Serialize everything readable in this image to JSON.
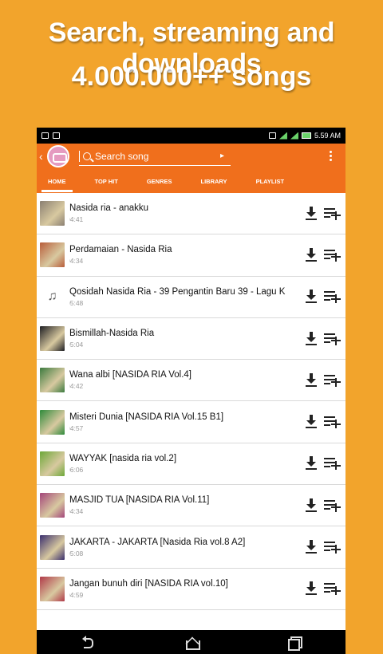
{
  "promo": {
    "line1": "Search, streaming and downloads",
    "line2": "4.000.000++ songs"
  },
  "statusbar": {
    "time": "5.59 AM"
  },
  "appbar": {
    "search_placeholder": "Search song",
    "back_icon": "chevron-left-icon",
    "menu_icon": "overflow-menu-icon"
  },
  "tabs": [
    {
      "label": "HOME",
      "active": true
    },
    {
      "label": "TOP HIT",
      "active": false
    },
    {
      "label": "GENRES",
      "active": false
    },
    {
      "label": "LIBRARY",
      "active": false
    },
    {
      "label": "PLAYLIST",
      "active": false
    }
  ],
  "songs": [
    {
      "title": "Nasida ria - anakku",
      "duration": "04:41",
      "thumb_color": "#8a7f72"
    },
    {
      "title": "Perdamaian - Nasida Ria",
      "duration": "04:34",
      "thumb_color": "#b85d3a"
    },
    {
      "title": "Qosidah Nasida Ria - 39 Pengantin Baru 39 - Lagu K",
      "duration": "05:48",
      "thumb_color": "none"
    },
    {
      "title": "Bismillah-Nasida Ria",
      "duration": "05:04",
      "thumb_color": "#1d1d22"
    },
    {
      "title": "Wana albi [NASIDA RIA Vol.4]",
      "duration": "04:42",
      "thumb_color": "#3c7a3e"
    },
    {
      "title": "Misteri Dunia [NASIDA RIA Vol.15 B1]",
      "duration": "04:57",
      "thumb_color": "#2e8a3a"
    },
    {
      "title": "WAYYAK [nasida ria vol.2]",
      "duration": "06:06",
      "thumb_color": "#6da838"
    },
    {
      "title": "MASJID TUA [NASIDA RIA Vol.11]",
      "duration": "04:34",
      "thumb_color": "#a3457a"
    },
    {
      "title": "JAKARTA - JAKARTA [Nasida Ria vol.8 A2]",
      "duration": "05:08",
      "thumb_color": "#3a2f6e"
    },
    {
      "title": "Jangan bunuh diri [NASIDA RIA vol.10]",
      "duration": "04:59",
      "thumb_color": "#b03a48"
    }
  ],
  "colors": {
    "background": "#F2A42C",
    "appbar": "#F06F1C"
  },
  "icons": {
    "download": "download-icon",
    "add_playlist": "playlist-add-icon"
  }
}
